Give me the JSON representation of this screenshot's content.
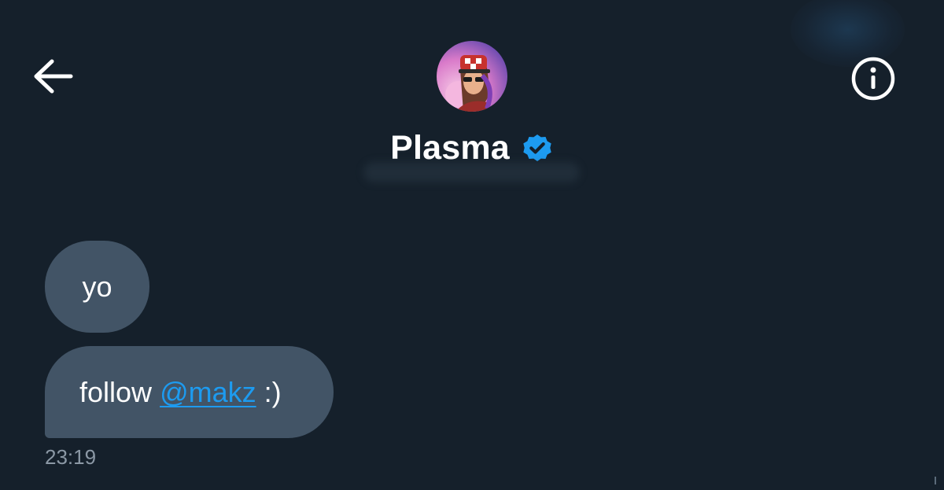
{
  "colors": {
    "background": "#15202b",
    "bubble": "#425466",
    "accent": "#1d9bf0",
    "muted_text": "#8b98a5",
    "text": "#ffffff"
  },
  "header": {
    "back_icon": "arrow-left-icon",
    "info_icon": "info-circle-icon",
    "avatar_icon": "user-avatar",
    "display_name": "Plasma",
    "verified_icon": "verified-badge-icon"
  },
  "messages": [
    {
      "text": "yo"
    },
    {
      "prefix": "follow",
      "mention": "@makz",
      "suffix": ":)"
    }
  ],
  "timestamp": "23:19"
}
